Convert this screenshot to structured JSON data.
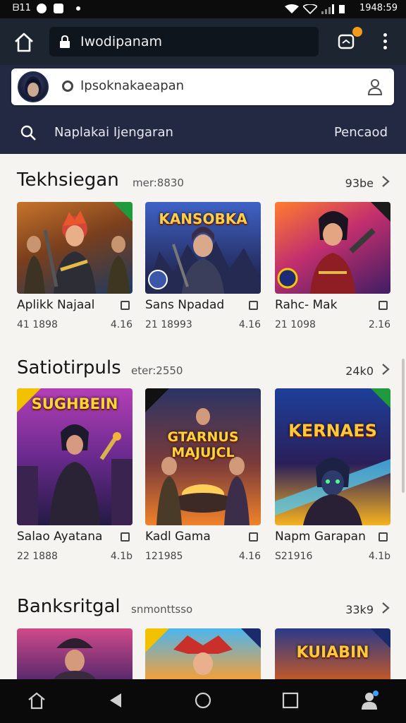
{
  "status": {
    "time_left": "ᗷ11",
    "time_right": "1948:59"
  },
  "browser": {
    "url": "Iwodipanam"
  },
  "account": {
    "text": "Ipsoknakaeapan"
  },
  "search": {
    "placeholder": "Naplakai Ijengaran",
    "action": "Pencaod"
  },
  "sections": [
    {
      "title": "Tekhsiegan",
      "meta": "mer:8830",
      "more": "93be",
      "cards": [
        {
          "name": "Aplikk Najaal",
          "downloads": "41 1898",
          "rating": "4.16"
        },
        {
          "name": "Sans Npadad",
          "downloads": "21 18993",
          "rating": "4.16",
          "art_title": "KANSOBKA"
        },
        {
          "name": "Rahc- Mak",
          "downloads": "21 1098",
          "rating": "2.16"
        }
      ]
    },
    {
      "title": "Satiotirpuls",
      "meta": "eter:2550",
      "more": "24k0",
      "cards": [
        {
          "name": "Salao Ayatana",
          "downloads": "22 1888",
          "rating": "4.1b",
          "art_title": "SUGHBEIN"
        },
        {
          "name": "Kadl Gama",
          "downloads": "121985",
          "rating": "4.16",
          "art_title": "GTARNUS MAJUJCL"
        },
        {
          "name": "Napm Garapan",
          "downloads": "S21916",
          "rating": "4.1b",
          "art_title": "KERNAES"
        }
      ]
    },
    {
      "title": "Banksritgal",
      "meta": "snmonttsso",
      "more": "33k9",
      "cards": [
        {
          "name": "",
          "downloads": "",
          "rating": ""
        },
        {
          "name": "",
          "downloads": "",
          "rating": ""
        },
        {
          "name": "",
          "downloads": "",
          "rating": "",
          "art_title": "KUIABIN"
        }
      ]
    }
  ],
  "colors": {
    "header": "#232843",
    "browser_bar": "#1d2530",
    "badge": "#f39a1d",
    "ribbon": "#1f9b3d"
  }
}
